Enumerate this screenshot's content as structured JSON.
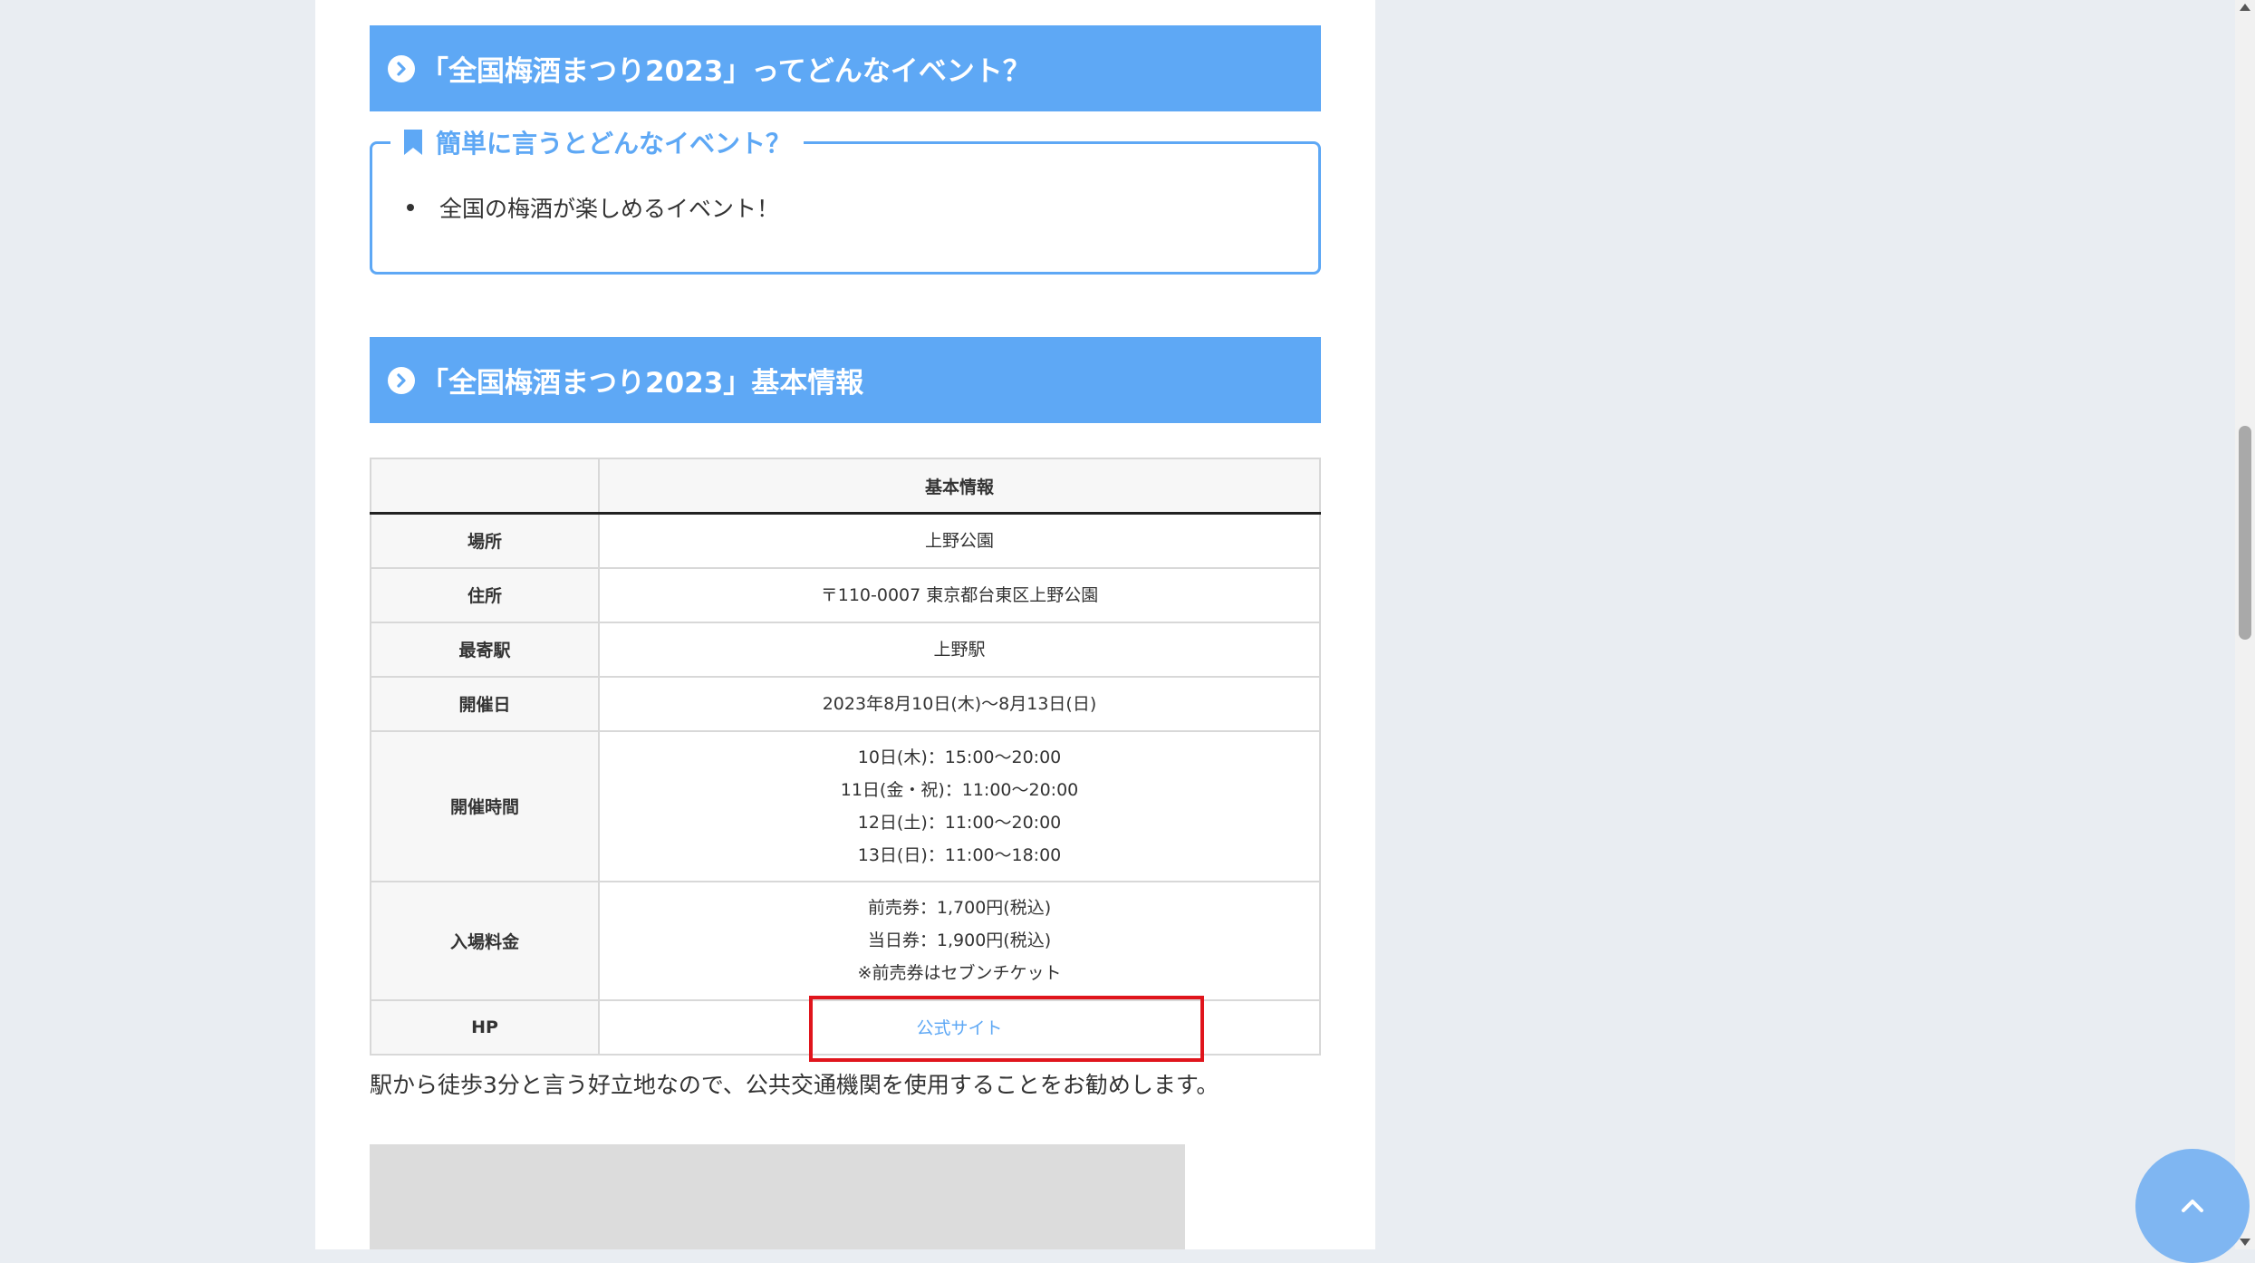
{
  "sections": {
    "event_heading": "「全国梅酒まつり2023」ってどんなイベント？",
    "summary_box": {
      "title": "簡単に言うとどんなイベント？",
      "items": [
        "全国の梅酒が楽しめるイベント！"
      ]
    },
    "info_heading": "「全国梅酒まつり2023」基本情報"
  },
  "table": {
    "header": [
      "",
      "基本情報"
    ],
    "rows": [
      {
        "label": "場所",
        "lines": [
          "上野公園"
        ]
      },
      {
        "label": "住所",
        "lines": [
          "〒110-0007 東京都台東区上野公園"
        ]
      },
      {
        "label": "最寄駅",
        "lines": [
          "上野駅"
        ]
      },
      {
        "label": "開催日",
        "lines": [
          "2023年8月10日(木)～8月13日(日)"
        ]
      },
      {
        "label": "開催時間",
        "lines": [
          "10日(木)：15:00～20:00",
          "11日(金・祝)：11:00～20:00",
          "12日(土)：11:00～20:00",
          "13日(日)：11:00～18:00"
        ]
      },
      {
        "label": "入場料金",
        "lines": [
          "前売券：1,700円(税込)",
          "当日券：1,900円(税込)",
          "※前売券はセブンチケット"
        ]
      },
      {
        "label": "HP",
        "link": "公式サイト"
      }
    ]
  },
  "paragraph": "駅から徒歩3分と言う好立地なので、公共交通機関を使用することをお勧めします。",
  "colors": {
    "accent": "#5ea8f5",
    "highlight": "#e0151c",
    "background": "#e9edf2"
  },
  "icons": [
    "chevron-right-circle-icon",
    "bookmark-icon",
    "chevron-up-icon"
  ]
}
